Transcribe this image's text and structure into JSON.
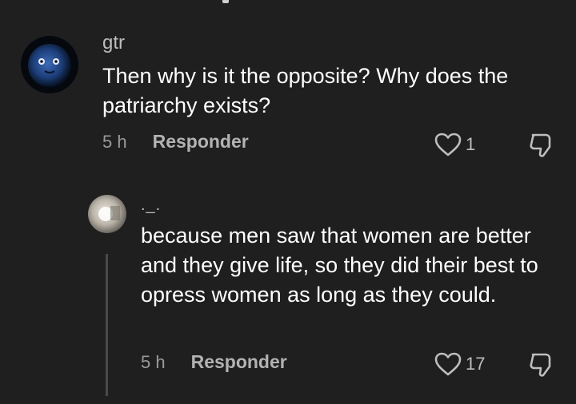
{
  "comments": [
    {
      "username": "gtr",
      "text": "Then why is it the opposite? Why does the patriarchy exists?",
      "time": "5 h",
      "reply_label": "Responder",
      "likes": "1",
      "avatar_icon": "blueberry-avatar-icon"
    },
    {
      "username": "._.",
      "text": "because men saw that women are better and they give life, so they did their best to opress women as long as they could.",
      "time": "5 h",
      "reply_label": "Responder",
      "likes": "17",
      "avatar_icon": "photo-avatar-icon"
    }
  ],
  "colors": {
    "background": "#1f1f1f",
    "text_primary": "#ffffff",
    "text_secondary": "#9a9a9a",
    "username": "#bdbdbd",
    "thread_line": "#4a4a4a"
  }
}
